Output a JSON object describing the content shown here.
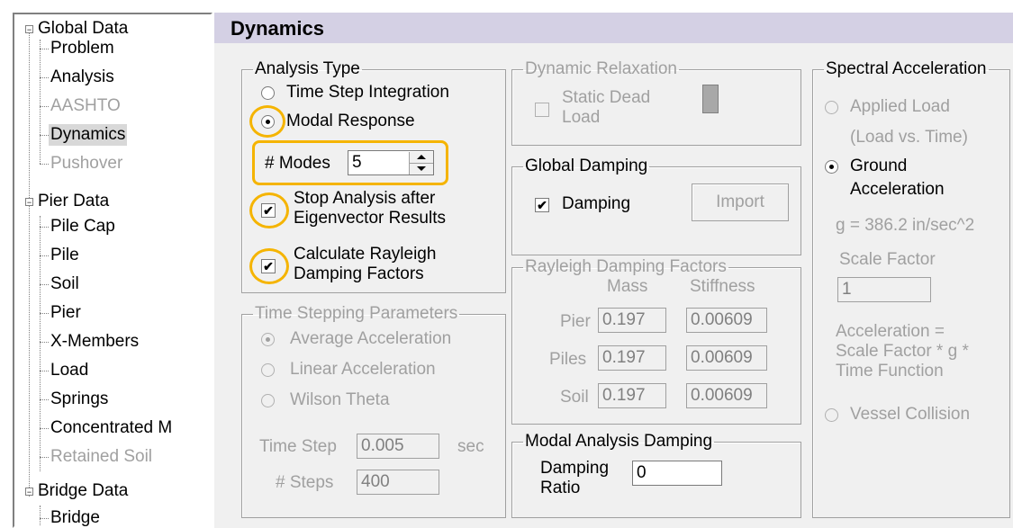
{
  "tree": {
    "items": [
      {
        "label": "Global Data",
        "disabled": false
      },
      {
        "label": "Problem",
        "disabled": false
      },
      {
        "label": "Analysis",
        "disabled": false
      },
      {
        "label": "AASHTO",
        "disabled": true
      },
      {
        "label": "Dynamics",
        "disabled": false
      },
      {
        "label": "Pushover",
        "disabled": true
      },
      {
        "label": "Pier Data",
        "disabled": false
      },
      {
        "label": "Pile Cap",
        "disabled": false
      },
      {
        "label": "Pile",
        "disabled": false
      },
      {
        "label": "Soil",
        "disabled": false
      },
      {
        "label": "Pier",
        "disabled": false
      },
      {
        "label": "X-Members",
        "disabled": false
      },
      {
        "label": "Load",
        "disabled": false
      },
      {
        "label": "Springs",
        "disabled": false
      },
      {
        "label": "Concentrated M",
        "disabled": false
      },
      {
        "label": "Retained Soil",
        "disabled": true
      },
      {
        "label": "Bridge Data",
        "disabled": false
      },
      {
        "label": "Bridge",
        "disabled": false
      }
    ],
    "expander_symbol": "−"
  },
  "page_title": "Dynamics",
  "analysis_type": {
    "legend": "Analysis Type",
    "time_step": "Time Step Integration",
    "modal_response": "Modal Response",
    "modes_label": "# Modes",
    "modes_value": "5",
    "stop_analysis": "Stop Analysis after Eigenvector Results",
    "stop_line1": "Stop Analysis after",
    "stop_line2": "Eigenvector Results",
    "rayleigh_line1": "Calculate Rayleigh",
    "rayleigh_line2": "Damping Factors",
    "check_mark": "✔"
  },
  "time_stepping": {
    "legend": "Time Stepping Parameters",
    "average": "Average Acceleration",
    "linear": "Linear Acceleration",
    "wilson": "Wilson Theta",
    "time_step_label": "Time Step",
    "time_step_value": "0.005",
    "time_step_unit": "sec",
    "steps_label": "# Steps",
    "steps_value": "400"
  },
  "dynamic_relaxation": {
    "legend": "Dynamic Relaxation",
    "static_line1": "Static Dead",
    "static_line2": "Load"
  },
  "global_damping": {
    "legend": "Global Damping",
    "damping": "Damping",
    "import": "Import",
    "check_mark": "✔"
  },
  "rayleigh": {
    "legend": "Rayleigh Damping Factors",
    "col_mass": "Mass",
    "col_stiffness": "Stiffness",
    "rows": [
      {
        "label": "Pier",
        "mass": "0.197",
        "stiffness": "0.00609"
      },
      {
        "label": "Piles",
        "mass": "0.197",
        "stiffness": "0.00609"
      },
      {
        "label": "Soil",
        "mass": "0.197",
        "stiffness": "0.00609"
      }
    ]
  },
  "modal_damping": {
    "legend": "Modal Analysis Damping",
    "label_line1": "Damping",
    "label_line2": "Ratio",
    "value": "0"
  },
  "spectral": {
    "legend": "Spectral Acceleration",
    "applied_line1": "Applied Load",
    "applied_line2": "(Load vs. Time)",
    "ground_line1": "Ground",
    "ground_line2": "Acceleration",
    "g_value": "g = 386.2 in/sec^2",
    "scale_label": "Scale Factor",
    "scale_value": "1",
    "formula_line1": "Acceleration =",
    "formula_line2": "Scale Factor * g *",
    "formula_line3": "Time Function",
    "vessel": "Vessel Collision"
  },
  "highlight_color": "#f5b400"
}
